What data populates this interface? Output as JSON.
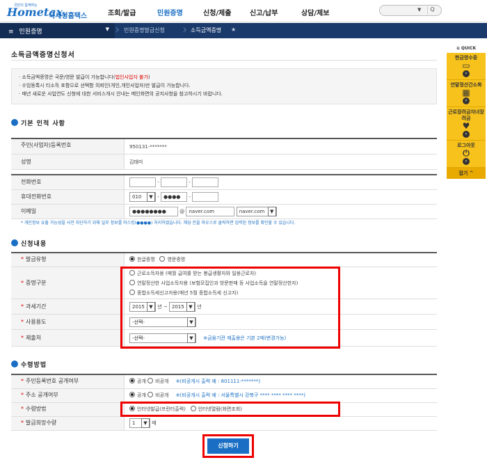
{
  "header": {
    "logo_small": "국민이 함께하는",
    "logo_main": "Hometax.",
    "logo_kr": "국세청홈택스",
    "menu": [
      "조회/발급",
      "민원증명",
      "신청/제출",
      "신고/납부",
      "상담/제보"
    ],
    "search_select": "▼",
    "search_icon": "Q"
  },
  "nav": {
    "home_label": "민원증명",
    "crumbs": [
      "민원증명발급신청",
      "소득금액증명"
    ]
  },
  "page": {
    "title": "소득금액증명신청서",
    "notice1_a": "소득금액증명은 국문/영문 발급이 가능합니다(",
    "notice1_red": "법인사업자 불가",
    "notice1_b": ")",
    "notice2": "수임동록시 티소득 포함으로 선택함 의뢰인(개인,개인사업자)만 발급이 가능합니다.",
    "notice3": "매년 새로운 사업연도 신청에 대한 서비스개시 안내는 메인화면의 공지사항을 참고하시기 바랍니다."
  },
  "basic": {
    "section_title": "기본 인적 사항",
    "rrn_label": "주민(사업자)등록번호",
    "rrn_value": "950131-*******",
    "name_label": "성명",
    "name_value": "김태미",
    "phone_label": "전화번호",
    "mobile_label": "휴대전화번호",
    "mobile_prefix": "010",
    "mobile_mid": "●●●●",
    "email_label": "이메일",
    "email_id": "●●●●●●●●",
    "email_at": "@",
    "email_domain": "naver.com",
    "email_select": "naver.com",
    "privacy_note": "* 개인정보 유출 가능성을 사전 차단하기 위해 일부 정보를 마스킹(●●●●) 처리하였습니다. 해당 칸을 마우스로 클릭하면 입력된 정보를 확인할 수 있습니다."
  },
  "apply": {
    "section_title": "신청내용",
    "lang_label": "발급유형",
    "lang_ko": "한글증명",
    "lang_en": "영문증명",
    "type_label": "증명구분",
    "type_opt1": "근로소득자용 (매월 급여를 받는 봉급생활자와 일용근로자)",
    "type_opt2": "연말정산한 사업소득자용 (보험모집인과 방문판매 등 사업소득을 연말정산한자)",
    "type_opt3": "종합소득세신고자용(매년 5월 종합소득세 신고자)",
    "period_label": "과세기간",
    "period_from": "2015",
    "period_year1": "년 ~",
    "period_to": "2015",
    "period_year2": "년",
    "purpose_label": "사용용도",
    "purpose_value": "-선택-",
    "submitto_label": "제출처",
    "submitto_value": "-선택-",
    "submitto_hint": "※금융기관 제출용은 기본 2매(변경가능)"
  },
  "receive": {
    "section_title": "수령방법",
    "rrn_open_label": "주민등록번호 공개여부",
    "open": "공개",
    "closed": "비공개",
    "rrn_hint": "※(비공개시 출력 예 : 801111-*******)",
    "addr_open_label": "주소 공개여부",
    "addr_hint": "※(비공개시 출력 예 : 서울특별시 강북구 **** **** **** ****)",
    "method_label": "수령방법",
    "method_print": "인터넷발급(프린터출력)",
    "method_view": "인터넷열람(화면조회)",
    "copies_label": "발급희망수량",
    "copies_value": "1",
    "copies_unit": "매"
  },
  "submit_label": "신청하기",
  "quick": {
    "title": "≡ QUICK",
    "items": [
      {
        "label": "현금영수증",
        "icon": "▭"
      },
      {
        "label": "연말정산간소화",
        "icon": "▦"
      },
      {
        "label": "근로장려금자녀장려금",
        "icon": "♥"
      },
      {
        "label": "로그아웃",
        "icon": "⏻"
      }
    ],
    "close": "접기 ^"
  }
}
